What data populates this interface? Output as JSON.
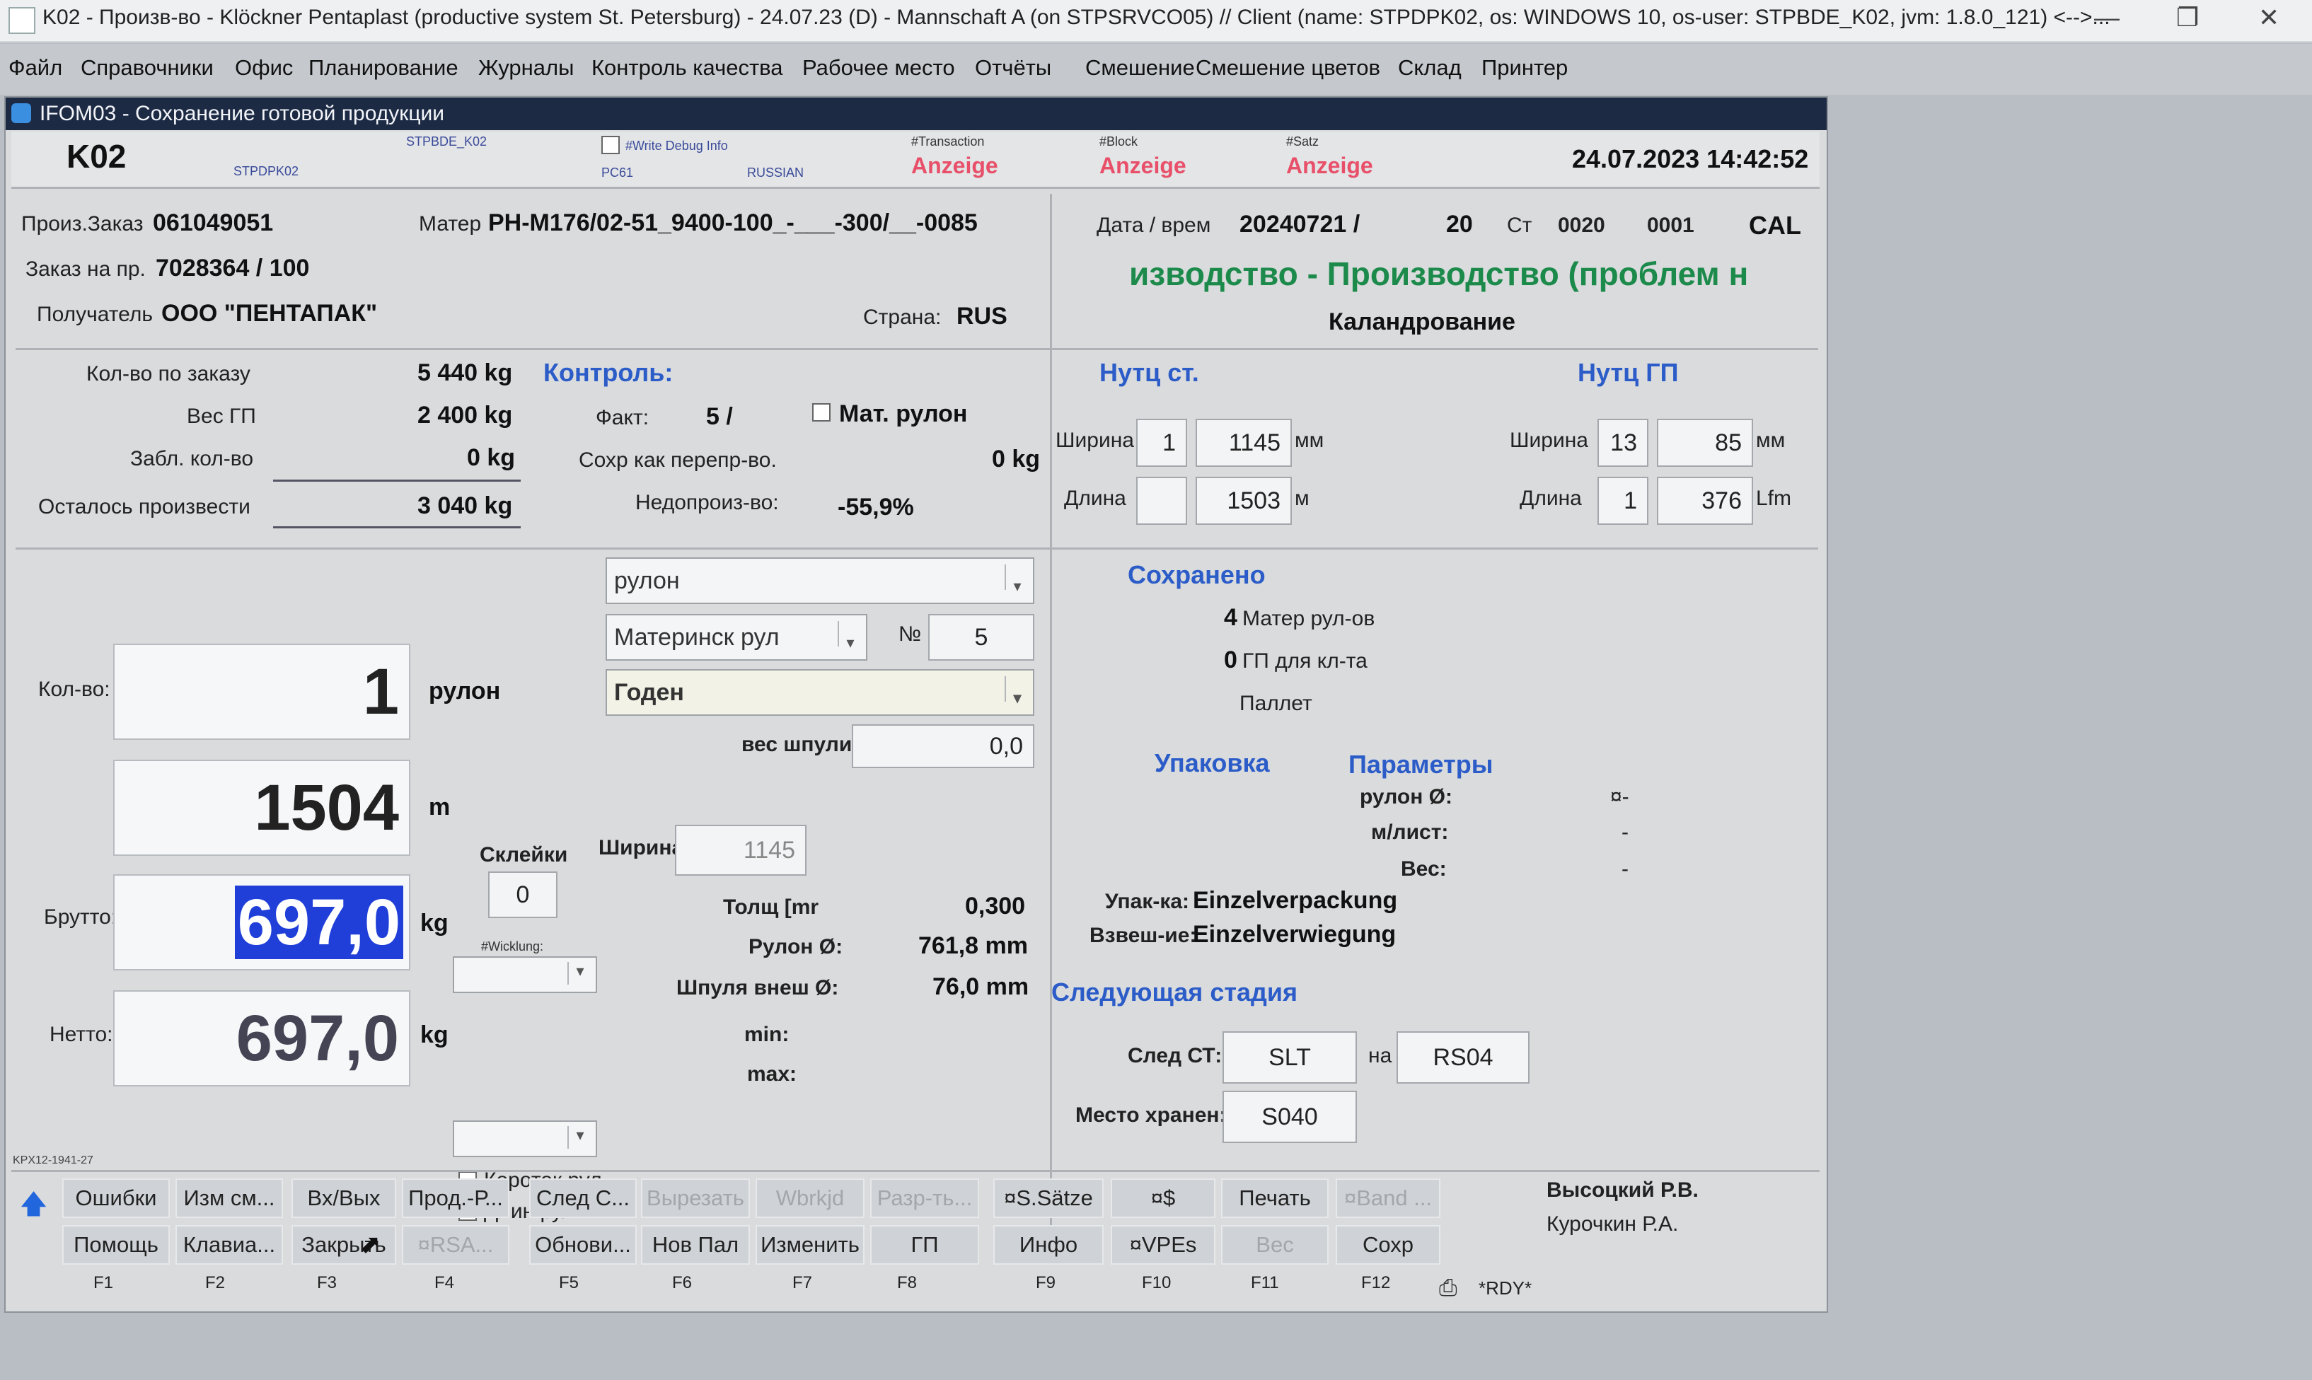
{
  "window": {
    "title": "K02 - Произв-во - Klöckner Pentaplast (productive system St. Petersburg) - 24.07.23 (D) - Mannschaft A (on STPSRVCO05) // Client (name: STPDPK02, os: WINDOWS 10, os-user: STPBDE_K02, jvm: 1.8.0_121) <-->..."
  },
  "menu": [
    "Файл",
    "Справочники",
    "Офис",
    "Планирование",
    "Журналы",
    "Контроль качества",
    "Рабочее место",
    "Отчёты",
    "Смешение",
    "Смешение цветов",
    "Склад",
    "Принтер"
  ],
  "inner_title": "IFOM03 - Сохранение готовой продукции",
  "header": {
    "station": "K02",
    "tiny_user": "STPBDE_K02",
    "tiny_client": "STPDPK02",
    "write_debug": "#Write Debug Info",
    "tiny_pc": "PC61",
    "tiny_lang": "RUSSIAN",
    "transaction_label": "#Transaction",
    "block_label": "#Block",
    "satz_label": "#Satz",
    "anzeige": "Anzeige",
    "datetime": "24.07.2023 14:42:52"
  },
  "order": {
    "order_label": "Произ.Заказ",
    "order_value": "061049051",
    "mater_label": "Матер",
    "mater_value": "PH-M176/02-51_9400-100_-___-300/__-0085",
    "sales_label": "Заказ на пр.",
    "sales_value": "7028364 / 100",
    "receiver_label": "Получатель",
    "receiver_value": "ООО \"ПЕНТАПАК\"",
    "country_label": "Страна:",
    "country_value": "RUS"
  },
  "dateinfo": {
    "label": "Дата / врем",
    "value": "20240721 /",
    "num": "20",
    "st_label": "Ст",
    "st_value": "0020",
    "st_suffix": "0001",
    "cal": "CAL",
    "production": "изводство - Производство (проблем н",
    "calendering": "Каландрование"
  },
  "quantities": {
    "order_qty_label": "Кол-во по заказу",
    "order_qty": "5 440 kg",
    "fp_weight_label": "Вес ГП",
    "fp_weight": "2 400 kg",
    "blocked_label": "Забл. кол-во",
    "blocked": "0 kg",
    "remaining_label": "Осталось произвести",
    "remaining": "3 040 kg"
  },
  "control": {
    "title": "Контроль:",
    "fact_label": "Факт:",
    "fact_value": "5 /",
    "mat_roll_label": "Мат. рулон",
    "saved_over_label": "Сохр как перепр-во.",
    "saved_over_value": "0 kg",
    "under_label": "Недопроиз-во:",
    "under_value": "-55,9%"
  },
  "norm_st": {
    "title": "Нутц ст.",
    "width_label": "Ширина",
    "width_a": "1",
    "width_b": "1145",
    "width_unit": "мм",
    "length_label": "Длина",
    "length_a": "",
    "length_b": "1503",
    "length_unit": "м"
  },
  "norm_gp": {
    "title": "Нутц ГП",
    "width_label": "Ширина",
    "width_a": "13",
    "width_b": "85",
    "width_unit": "мм",
    "length_label": "Длина",
    "length_a": "1",
    "length_b": "376",
    "length_unit": "Lfm"
  },
  "entry": {
    "type_combo": "рулон",
    "mother_combo": "Материнск рул",
    "no_label": "№",
    "no_value": "5",
    "status_combo": "Годен",
    "core_weight_label": "вес шпули:",
    "core_weight_value": "0,0",
    "qty_label": "Кол-во:",
    "qty_value": "1",
    "qty_unit": "рулон",
    "length_value": "1504",
    "length_unit": "m",
    "splices_label": "Склейки",
    "splices_value": "0",
    "width_label": "Ширина",
    "width_value": "1145",
    "gross_label": "Брутто:",
    "gross_value": "697,0",
    "gross_unit": "kg",
    "winding_label": "#Wicklung:",
    "net_label": "Нетто:",
    "net_value": "697,0",
    "net_unit": "kg",
    "short_roll": "Короток рул",
    "long_roll": "Длин рул",
    "thickness_label": "Толщ [mr",
    "thickness_value": "0,300",
    "roll_diam_label": "Рулон Ø:",
    "roll_diam_value": "761,8 mm",
    "core_diam_label": "Шпуля внеш Ø:",
    "core_diam_value": "76,0 mm",
    "min_label": "min:",
    "max_label": "max:"
  },
  "saved": {
    "title": "Сохранено",
    "mother_count": "4",
    "mother_label": "Матер рул-ов",
    "gp_count": "0",
    "gp_label": "ГП для кл-та",
    "pallet_label": "Паллет"
  },
  "packaging": {
    "title": "Упаковка",
    "params_title": "Параметры",
    "roll_diam_label": "рулон Ø:",
    "roll_diam_value": "¤-",
    "sheet_label": "м/лист:",
    "sheet_value": "-",
    "weight_label": "Вес:",
    "weight_value": "-",
    "pack_label": "Упак-ка:",
    "pack_value": "Einzelverpackung",
    "weigh_label": "Взвеш-ие:",
    "weigh_value": "Einzelverwiegung"
  },
  "next_stage": {
    "title": "Следующая стадия",
    "next_st_label": "След СТ:",
    "next_st_value": "SLT",
    "on_label": "на",
    "on_value": "RS04",
    "storage_label": "Место хранен:",
    "storage_value": "S040"
  },
  "footer_tiny": "KPX12-1941-27",
  "buttons_row1": [
    "Ошибки",
    "Изм см...",
    "Вх/Вых",
    "Прод.-Р...",
    "След С...",
    "Вырезать",
    "Wbrkjd",
    "Разр-ть...",
    "¤S.Sätze",
    "¤$",
    "Печать",
    "¤Band ..."
  ],
  "buttons_row2": [
    "Помощь",
    "Клавиа...",
    "Закрыть",
    "¤RSA...",
    "Обнови...",
    "Нов Пал",
    "Изменить",
    "ГП",
    "Инфо",
    "¤VPEs",
    "Вес",
    "Сохр"
  ],
  "fkeys": [
    "F1",
    "F2",
    "F3",
    "F4",
    "F5",
    "F6",
    "F7",
    "F8",
    "F9",
    "F10",
    "F11",
    "F12"
  ],
  "users": [
    "Высоцкий Р.В.",
    "Курочкин Р.А."
  ],
  "status": "*RDY*"
}
